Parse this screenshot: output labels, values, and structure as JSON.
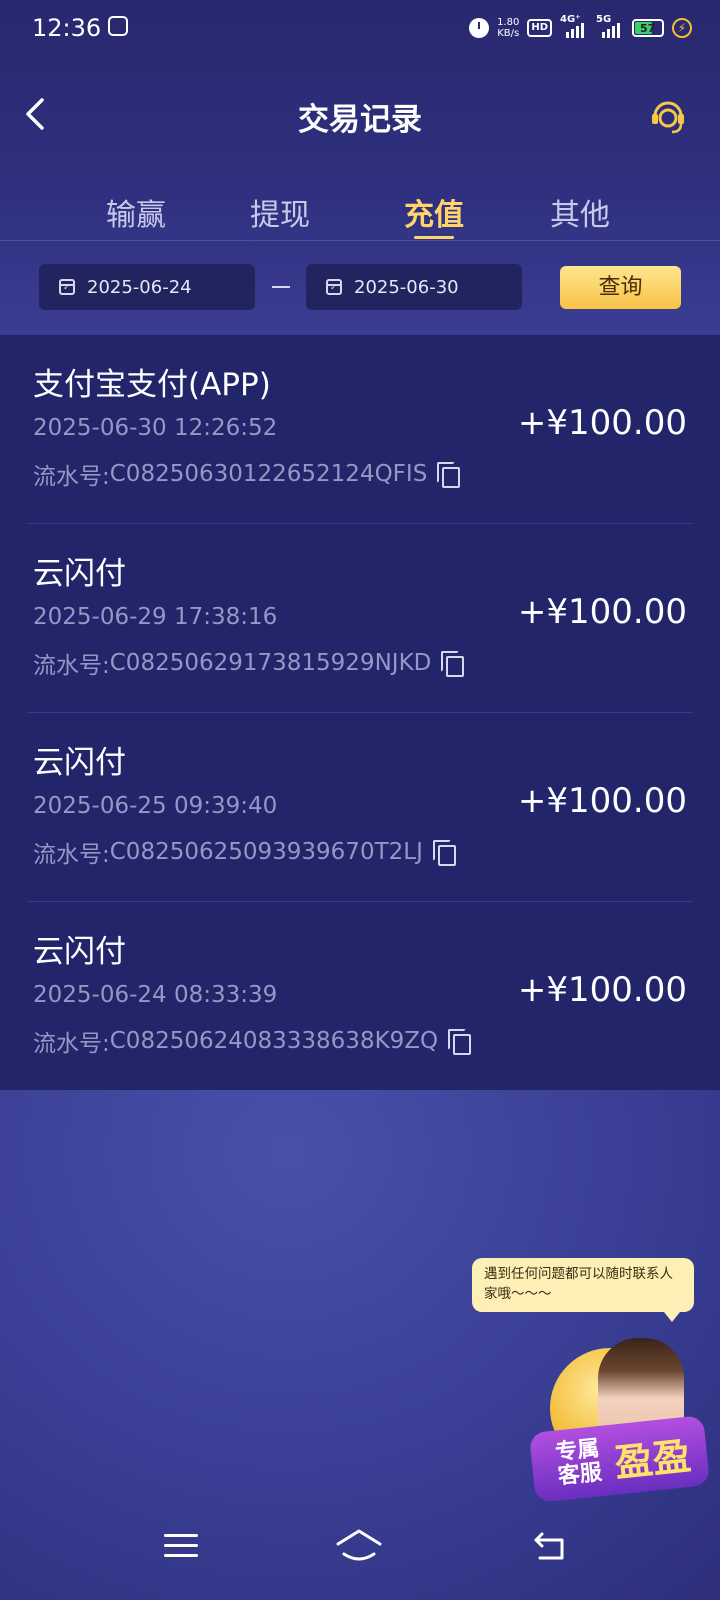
{
  "status_bar": {
    "time": "12:36",
    "net_speed_value": "1.80",
    "net_speed_unit": "KB/s",
    "hd_label": "HD",
    "sim1_label": "4G⁺",
    "sim2_label": "5G",
    "battery": "57"
  },
  "header": {
    "title": "交易记录"
  },
  "tabs": [
    {
      "label": "输赢",
      "active": false
    },
    {
      "label": "提现",
      "active": false
    },
    {
      "label": "充值",
      "active": true
    },
    {
      "label": "其他",
      "active": false
    }
  ],
  "filter": {
    "start_date": "2025-06-24",
    "end_date": "2025-06-30",
    "query_label": "查询"
  },
  "serial_prefix": "流水号: ",
  "records": [
    {
      "method": "支付宝支付(APP)",
      "time": "2025-06-30 12:26:52",
      "serial": "C08250630122652124QFIS",
      "amount": "+¥100.00"
    },
    {
      "method": "云闪付",
      "time": "2025-06-29 17:38:16",
      "serial": "C08250629173815929NJKD",
      "amount": "+¥100.00"
    },
    {
      "method": "云闪付",
      "time": "2025-06-25 09:39:40",
      "serial": "C08250625093939670T2LJ",
      "amount": "+¥100.00"
    },
    {
      "method": "云闪付",
      "time": "2025-06-24 08:33:39",
      "serial": "C08250624083338638K9ZQ",
      "amount": "+¥100.00"
    }
  ],
  "floating_cs": {
    "bubble_text": "遇到任何问题都可以随时联系人家哦～～～",
    "label_left": "专属客服",
    "label_right": "盈盈"
  },
  "colors": {
    "accent_gold": "#ffd56b",
    "list_bg": "#22256a",
    "page_bg": "#2d2f7c"
  }
}
